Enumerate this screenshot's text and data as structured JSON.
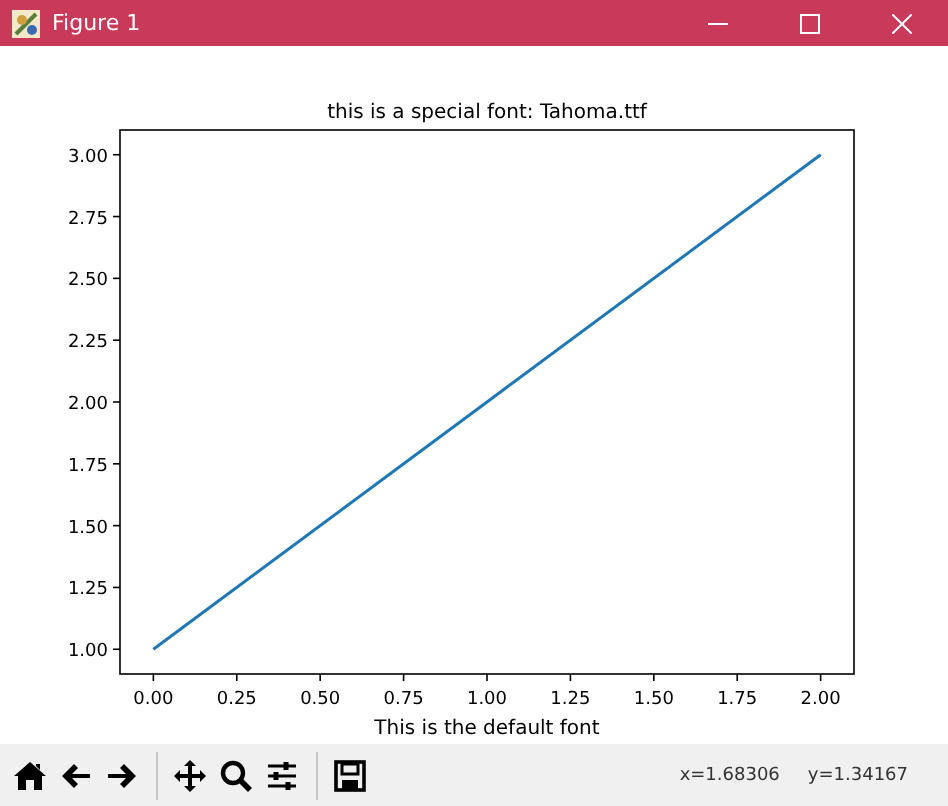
{
  "window": {
    "title": "Figure 1"
  },
  "figure": {
    "chart_data": {
      "type": "line",
      "title": "this is a special font: Tahoma.ttf",
      "xlabel": "This is the default font",
      "x": [
        0,
        1,
        2
      ],
      "series": [
        {
          "color": "#1f77b4",
          "values": [
            1,
            2,
            3
          ]
        }
      ],
      "xlim": [
        -0.1,
        2.1
      ],
      "ylim": [
        0.9,
        3.1
      ],
      "xticks": [
        {
          "value": 0,
          "label": "0.00"
        },
        {
          "value": 0.25,
          "label": "0.25"
        },
        {
          "value": 0.5,
          "label": "0.50"
        },
        {
          "value": 0.75,
          "label": "0.75"
        },
        {
          "value": 1,
          "label": "1.00"
        },
        {
          "value": 1.25,
          "label": "1.25"
        },
        {
          "value": 1.5,
          "label": "1.50"
        },
        {
          "value": 1.75,
          "label": "1.75"
        },
        {
          "value": 2,
          "label": "2.00"
        }
      ],
      "yticks": [
        {
          "value": 1,
          "label": "1.00"
        },
        {
          "value": 1.25,
          "label": "1.25"
        },
        {
          "value": 1.5,
          "label": "1.50"
        },
        {
          "value": 1.75,
          "label": "1.75"
        },
        {
          "value": 2,
          "label": "2.00"
        },
        {
          "value": 2.25,
          "label": "2.25"
        },
        {
          "value": 2.5,
          "label": "2.50"
        },
        {
          "value": 2.75,
          "label": "2.75"
        },
        {
          "value": 3,
          "label": "3.00"
        }
      ]
    }
  },
  "toolbar": {
    "buttons": [
      {
        "kind": "home"
      },
      {
        "kind": "back"
      },
      {
        "kind": "forward"
      },
      {
        "kind": "separator"
      },
      {
        "kind": "pan"
      },
      {
        "kind": "zoom"
      },
      {
        "kind": "configure"
      },
      {
        "kind": "separator"
      },
      {
        "kind": "save"
      }
    ],
    "coordinates": [
      "x=1.68306",
      "y=1.34167"
    ]
  }
}
